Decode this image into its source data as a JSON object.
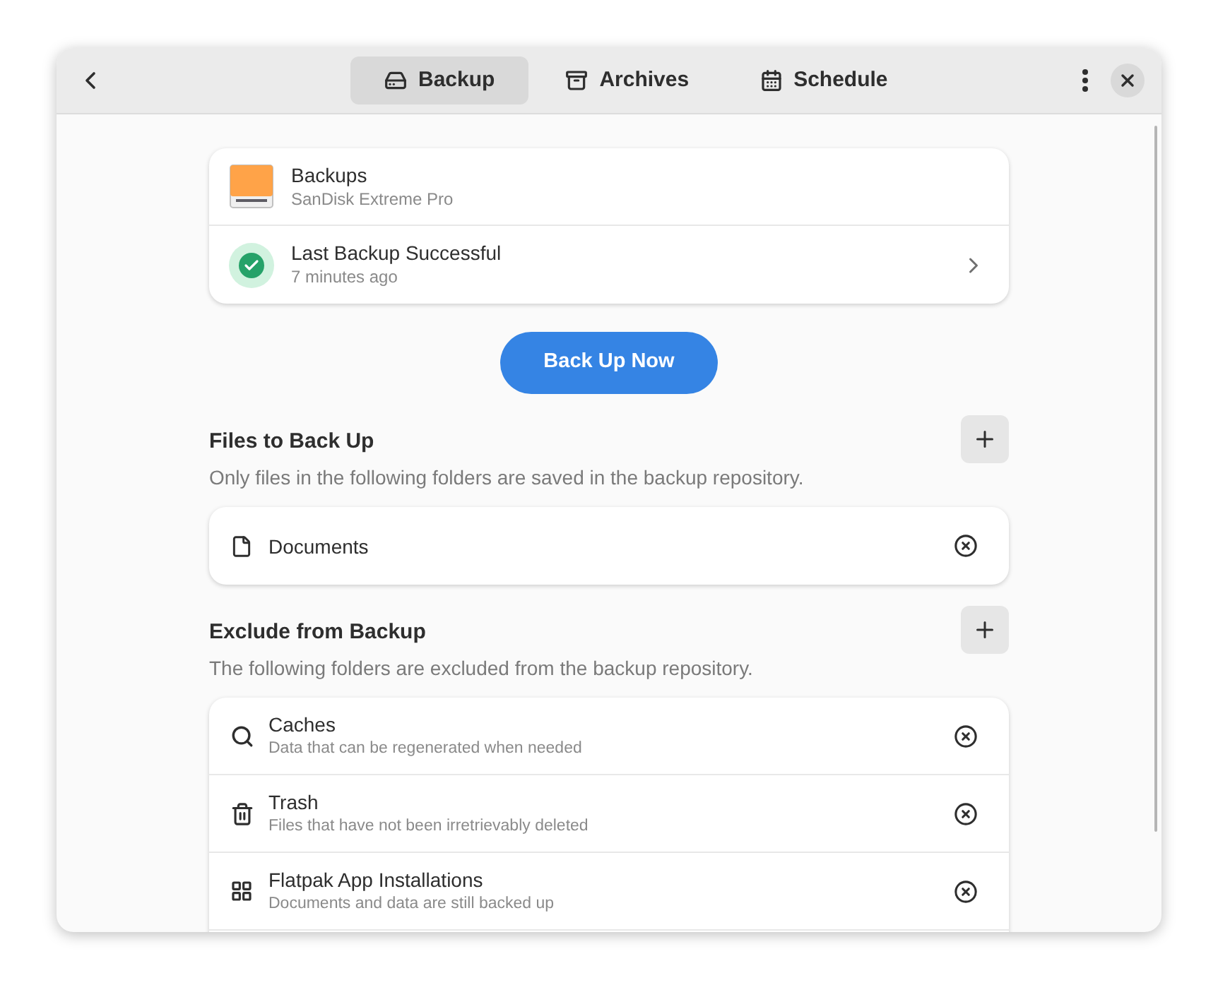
{
  "tabs": [
    {
      "label": "Backup",
      "kind": "drive",
      "selected": true
    },
    {
      "label": "Archives",
      "kind": "archive",
      "selected": false
    },
    {
      "label": "Schedule",
      "kind": "calendar",
      "selected": false
    }
  ],
  "status_card": {
    "repository": {
      "title": "Backups",
      "subtitle": "SanDisk Extreme Pro"
    },
    "last_backup": {
      "title": "Last Backup Successful",
      "subtitle": "7 minutes ago"
    }
  },
  "primary_button": "Back Up Now",
  "include": {
    "title": "Files to Back Up",
    "description": "Only files in the following folders are saved in the backup repository.",
    "items": [
      {
        "title": "Documents",
        "kind": "file"
      }
    ]
  },
  "exclude": {
    "title": "Exclude from Backup",
    "description": "The following folders are excluded from the backup repository.",
    "items": [
      {
        "title": "Caches",
        "subtitle": "Data that can be regenerated when needed",
        "kind": "search"
      },
      {
        "title": "Trash",
        "subtitle": "Files that have not been irretrievably deleted",
        "kind": "trash"
      },
      {
        "title": "Flatpak App Installations",
        "subtitle": "Documents and data are still backed up",
        "kind": "grid"
      }
    ]
  }
}
